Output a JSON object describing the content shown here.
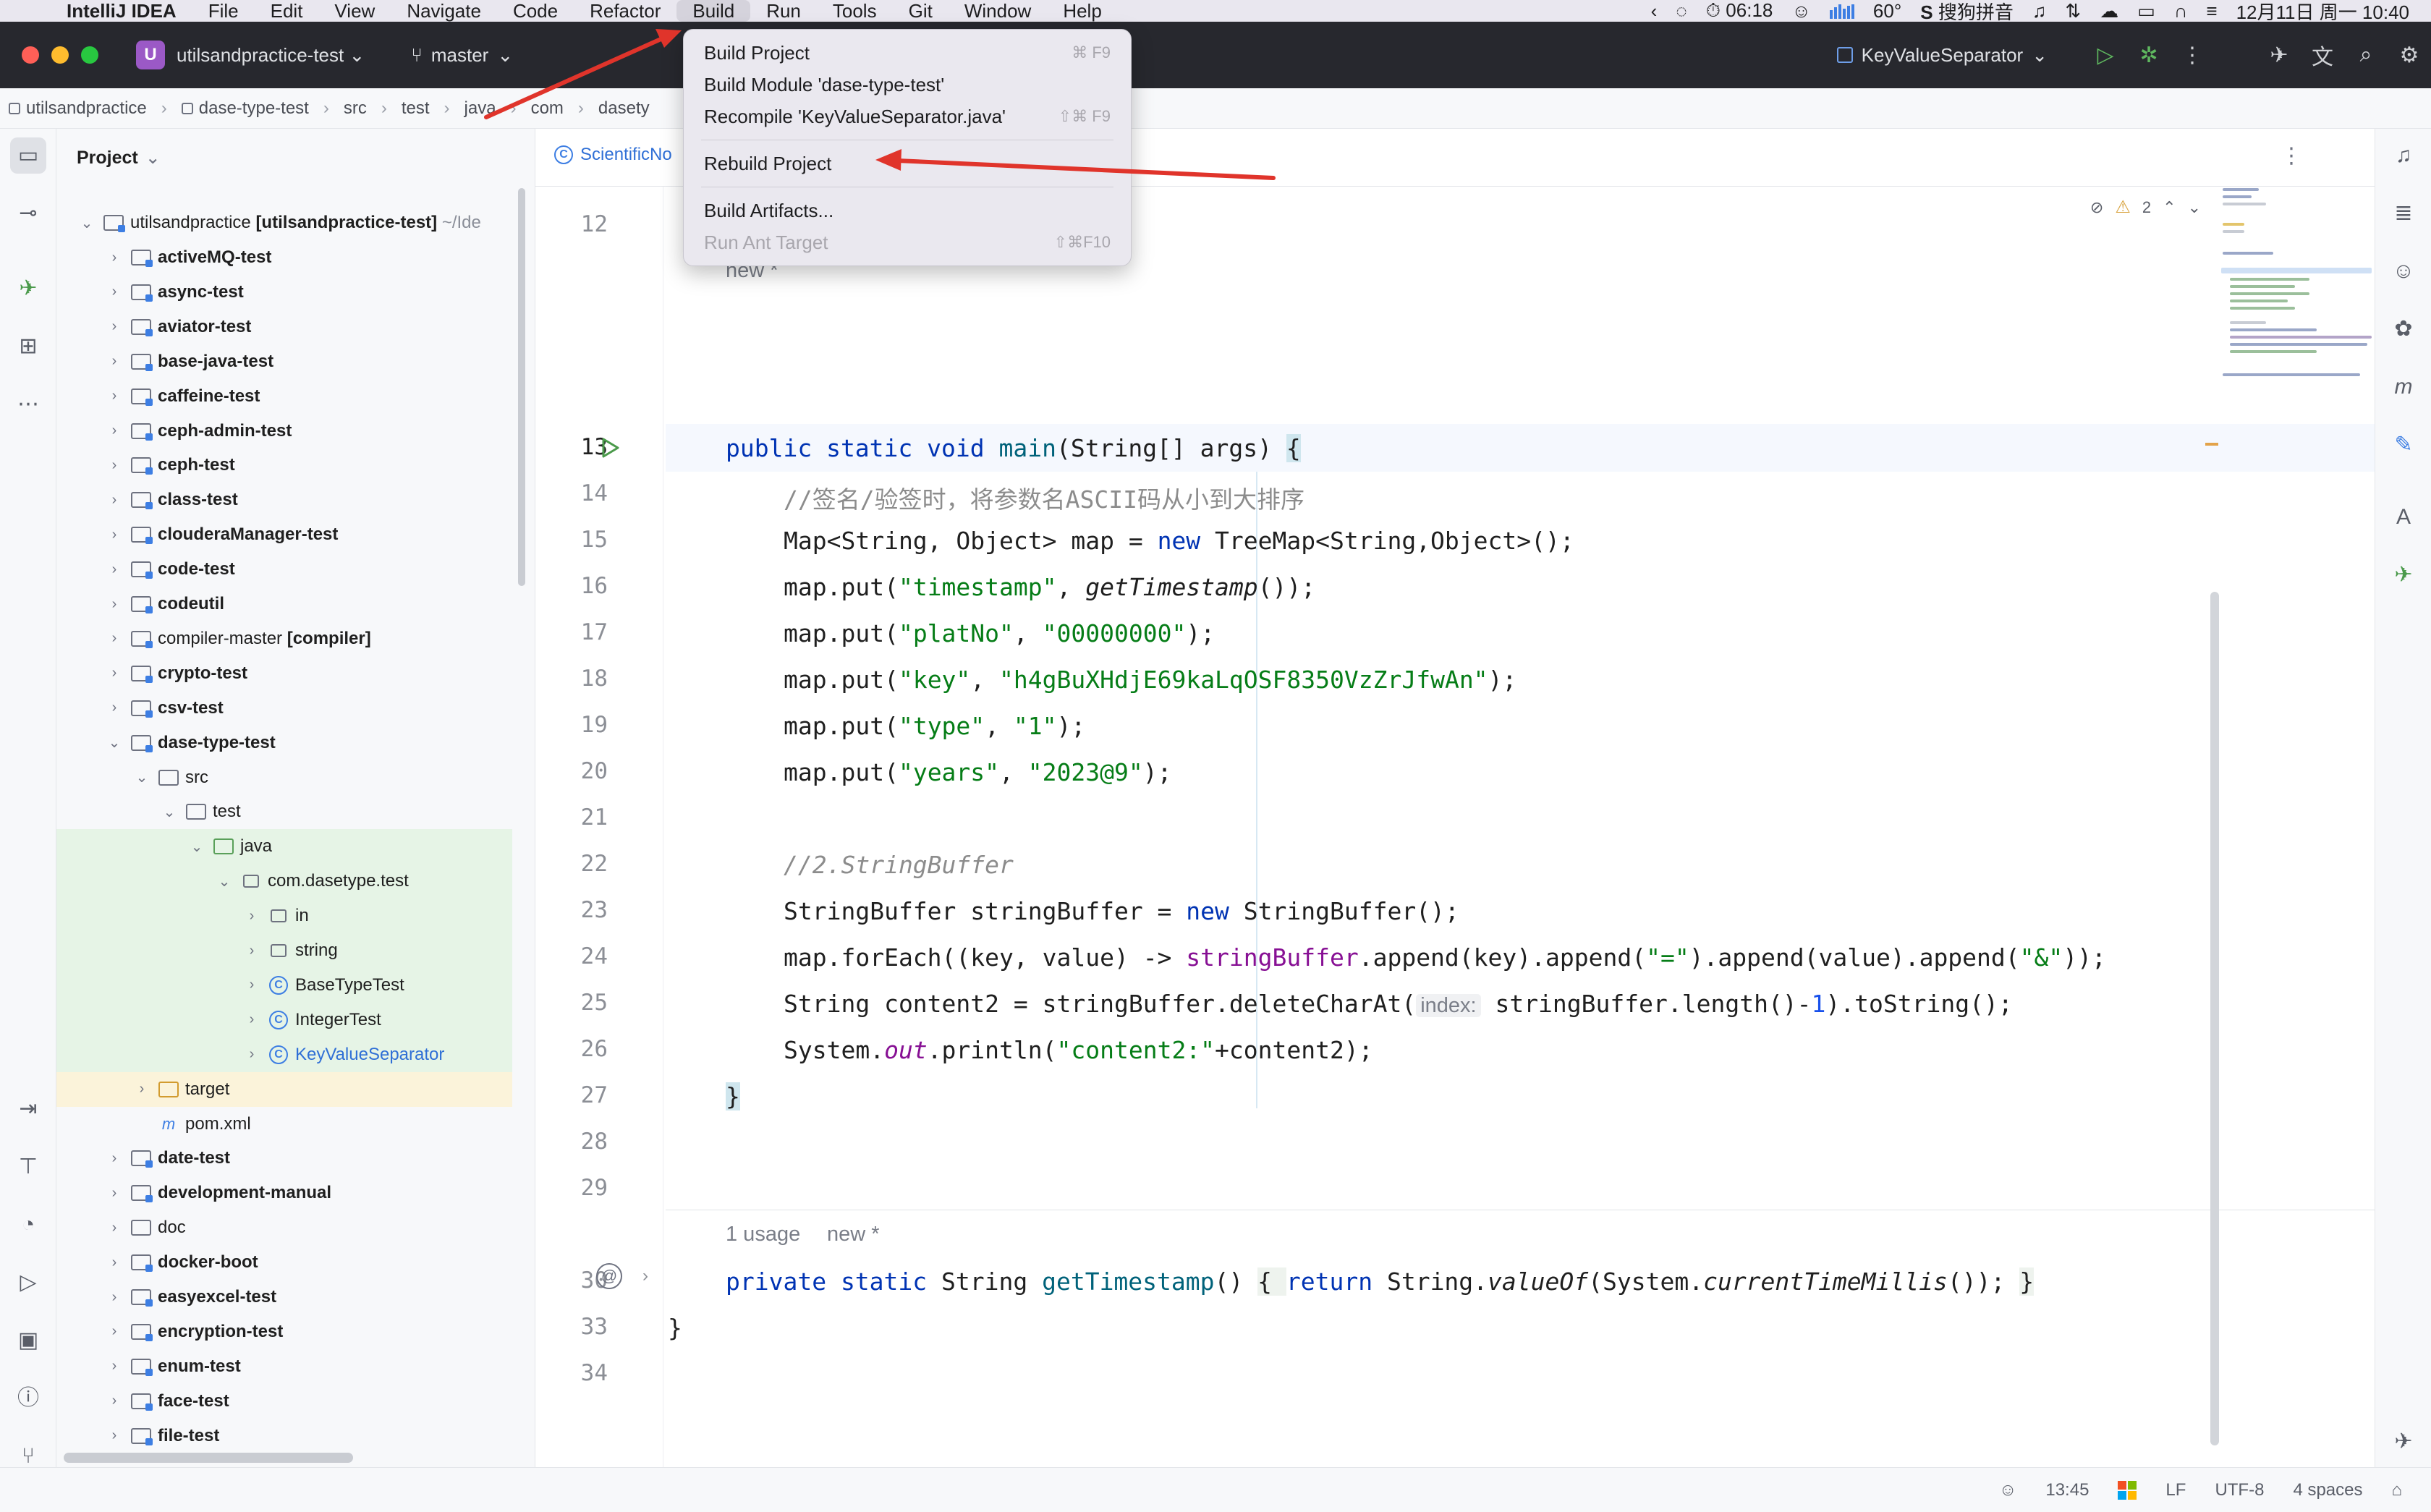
{
  "menubar": {
    "app_name": "IntelliJ IDEA",
    "menus": [
      "File",
      "Edit",
      "View",
      "Navigate",
      "Code",
      "Refactor",
      "Build",
      "Run",
      "Tools",
      "Git",
      "Window",
      "Help"
    ],
    "active_menu": "Build",
    "status": {
      "timer": "06:18",
      "cpu_label": "60°",
      "input_method": "搜狗拼音",
      "datetime": "12月11日 周一 10:40"
    }
  },
  "titlebar": {
    "project_badge": "U",
    "project_name": "utilsandpractice-test",
    "branch": "master",
    "run_config": "KeyValueSeparator"
  },
  "breadcrumb": [
    "utilsandpractice",
    "dase-type-test",
    "src",
    "test",
    "java",
    "com",
    "dasety"
  ],
  "project_panel": {
    "title": "Project",
    "root": {
      "name": "utilsandpractice",
      "module": "[utilsandpractice-test]",
      "path": "~/Ide"
    },
    "rows": [
      {
        "label": "activeMQ-test"
      },
      {
        "label": "async-test"
      },
      {
        "label": "aviator-test"
      },
      {
        "label": "base-java-test"
      },
      {
        "label": "caffeine-test"
      },
      {
        "label": "ceph-admin-test"
      },
      {
        "label": "ceph-test"
      },
      {
        "label": "class-test"
      },
      {
        "label": "clouderaManager-test"
      },
      {
        "label": "code-test"
      },
      {
        "label": "codeutil"
      },
      {
        "label": "compiler-master",
        "suffix": "[compiler]"
      },
      {
        "label": "crypto-test"
      },
      {
        "label": "csv-test"
      },
      {
        "label": "dase-type-test"
      },
      {
        "label": "src"
      },
      {
        "label": "test"
      },
      {
        "label": "java"
      },
      {
        "label": "com.dasetype.test"
      },
      {
        "label": "in"
      },
      {
        "label": "string"
      },
      {
        "label": "BaseTypeTest"
      },
      {
        "label": "IntegerTest"
      },
      {
        "label": "KeyValueSeparator"
      },
      {
        "label": "target"
      },
      {
        "label": "pom.xml"
      },
      {
        "label": "date-test"
      },
      {
        "label": "development-manual"
      },
      {
        "label": "doc"
      },
      {
        "label": "docker-boot"
      },
      {
        "label": "easyexcel-test"
      },
      {
        "label": "encryption-test"
      },
      {
        "label": "enum-test"
      },
      {
        "label": "face-test"
      },
      {
        "label": "file-test"
      }
    ]
  },
  "editor": {
    "tab_label": "ScientificNo",
    "inspection_warnings": "2",
    "line_numbers": [
      "12",
      "13",
      "14",
      "15",
      "16",
      "17",
      "18",
      "19",
      "20",
      "21",
      "22",
      "23",
      "24",
      "25",
      "26",
      "27",
      "28",
      "29",
      "30",
      "33",
      "34"
    ],
    "hints": {
      "new_label": "new *",
      "usage_label": "1 usage",
      "new_label2": "new *",
      "index_inlay": "index:"
    },
    "code": {
      "l13": {
        "kw": "public static void ",
        "fn": "main",
        "rest": "(String[] args) ",
        "brace": "{"
      },
      "l14": "//签名/验签时，将参数名ASCII码从小到大排序",
      "l15": {
        "a": "Map<String, Object> map = ",
        "kw": "new",
        "b": " TreeMap<String,Object>();"
      },
      "l16": {
        "a": "map.put(",
        "s1": "\"timestamp\"",
        "b": ", ",
        "f": "getTimestamp",
        "c": "());"
      },
      "l17": {
        "a": "map.put(",
        "s1": "\"platNo\"",
        "b": ", ",
        "s2": "\"00000000\"",
        "c": ");"
      },
      "l18": {
        "a": "map.put(",
        "s1": "\"key\"",
        "b": ", ",
        "s2": "\"h4gBuXHdjE69kaLqOSF8350VzZrJfwAn\"",
        "c": ");"
      },
      "l19": {
        "a": "map.put(",
        "s1": "\"type\"",
        "b": ", ",
        "s2": "\"1\"",
        "c": ");"
      },
      "l20": {
        "a": "map.put(",
        "s1": "\"years\"",
        "b": ", ",
        "s2": "\"2023@9\"",
        "c": ");"
      },
      "l22": "//2.StringBuffer",
      "l23": {
        "a": "StringBuffer stringBuffer = ",
        "kw": "new",
        "b": " StringBuffer();"
      },
      "l24": {
        "a": "map.forEach((key, value) -> ",
        "p": "stringBuffer",
        "b": ".append(key).append(",
        "s1": "\"=\"",
        "c": ").append(value).append(",
        "s2": "\"&\"",
        "d": "));"
      },
      "l25": {
        "a": "String content2 = stringBuffer.deleteCharAt(",
        "b": "stringBuffer.length()-",
        "n": "1",
        "c": ").toString();"
      },
      "l26": {
        "a": "System.",
        "p": "out",
        "b": ".println(",
        "s1": "\"content2:\"",
        "c": "+content2);"
      },
      "l27": "}",
      "l30": {
        "kw": "private static ",
        "a": "String ",
        "fn": "getTimestamp",
        "b": "() ",
        "c": "{ ",
        "kw2": "return",
        "d": " String.",
        "i1": "valueOf",
        "e": "(System.",
        "i2": "currentTimeMillis",
        "f": "()); ",
        "g": "}"
      },
      "l33": "}"
    }
  },
  "build_menu": {
    "items": [
      {
        "label": "Build Project",
        "shortcut": "⌘ F9",
        "enabled": true
      },
      {
        "label": "Build Module 'dase-type-test'",
        "shortcut": "",
        "enabled": true
      },
      {
        "label": "Recompile 'KeyValueSeparator.java'",
        "shortcut": "⇧⌘ F9",
        "enabled": true
      },
      {
        "label": "Rebuild Project",
        "shortcut": "",
        "enabled": true
      },
      {
        "label": "Build Artifacts...",
        "shortcut": "",
        "enabled": true
      },
      {
        "label": "Run Ant Target",
        "shortcut": "⇧⌘F10",
        "enabled": false
      }
    ]
  },
  "statusbar": {
    "position": "13:45",
    "line_ending": "LF",
    "encoding": "UTF-8",
    "indent": "4 spaces"
  },
  "colors": {
    "annotation_arrow": "#e0342b",
    "keyword": "#0033b3",
    "string": "#067d17",
    "comment": "#8c8c8c"
  }
}
